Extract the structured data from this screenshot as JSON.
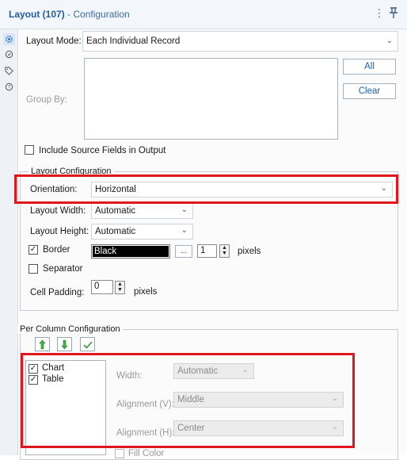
{
  "header": {
    "title_bold": "Layout (107)",
    "title_rest": " - Configuration",
    "menu_glyph": "⋮",
    "pin_glyph": "⊥"
  },
  "sidebar_icons": [
    "gear-icon",
    "tool-icon",
    "tag-icon",
    "help-icon"
  ],
  "layout_mode": {
    "label": "Layout Mode:",
    "value": "Each Individual Record"
  },
  "group_by": {
    "label": "Group By:",
    "all_label": "All",
    "clear_label": "Clear"
  },
  "include_source": {
    "label": "Include Source Fields in Output",
    "checked": false
  },
  "layout_config": {
    "legend": "Layout Configuration",
    "orientation": {
      "label": "Orientation:",
      "value": "Horizontal"
    },
    "layout_width": {
      "label": "Layout Width:",
      "value": "Automatic"
    },
    "layout_height": {
      "label": "Layout Height:",
      "value": "Automatic"
    },
    "border": {
      "label": "Border",
      "checked": true,
      "color": "Black",
      "color_hex": "#000000",
      "more": "...",
      "width": "1",
      "unit": "pixels"
    },
    "separator": {
      "label": "Separator",
      "checked": false
    },
    "cell_padding": {
      "label": "Cell Padding:",
      "value": "0",
      "unit": "pixels"
    }
  },
  "per_column": {
    "legend": "Per Column Configuration",
    "items": [
      {
        "label": "Chart",
        "checked": true
      },
      {
        "label": "Table",
        "checked": true
      }
    ],
    "width": {
      "label": "Width:",
      "value": "Automatic"
    },
    "align_v": {
      "label": "Alignment (V):",
      "value": "Middle"
    },
    "align_h": {
      "label": "Alignment (H):",
      "value": "Center"
    },
    "fill_color": {
      "label": "Fill Color"
    }
  },
  "colors": {
    "highlight": "#e0161c",
    "title": "#1f5fa0"
  }
}
